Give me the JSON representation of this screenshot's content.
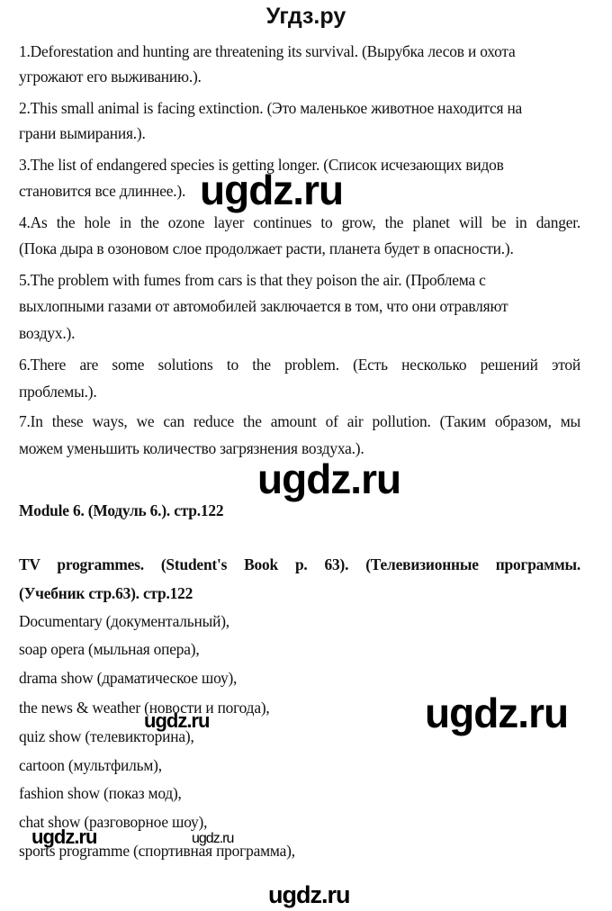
{
  "header": {
    "site_title": "Угдз.ру"
  },
  "sentences": [
    {
      "line1": "1.Deforestation and hunting are threatening its survival. (Вырубка лесов и охота",
      "line2": "угрожают его выживанию.)."
    },
    {
      "line1": "2.This small animal is facing extinction. (Это маленькое животное находится на",
      "line2": "грани вымирания.)."
    },
    {
      "line1": "3.The list of endangered species is getting longer. (Список исчезающих видов",
      "line2": "становится все длиннее.)."
    },
    {
      "line1": "4.As the hole in the ozone layer continues to grow, the planet will be in danger.",
      "line2": "(Пока дыра в озоновом слое продолжает расти, планета будет в опасности.)."
    },
    {
      "line1": "5.The problem with fumes from cars is that they poison the air. (Проблема с",
      "line2": "выхлопными газами от автомобилей заключается в том, что они отравляют",
      "line3": "воздух.)."
    },
    {
      "line1": "6.There are some solutions to the problem. (Есть несколько решений этой",
      "line2": "проблемы.)."
    },
    {
      "line1": "7.In these ways, we can reduce the amount of air pollution. (Таким образом, мы",
      "line2": "можем уменьшить количество загрязнения воздуха.)."
    }
  ],
  "module_heading": "Module 6. (Модуль 6.). стр.122",
  "section_heading": {
    "line1": "TV programmes. (Student's Book p. 63). (Телевизионные программы.",
    "line2": "(Учебник стр.63). стр.122"
  },
  "tv_programmes": [
    "Documentary (документальный),",
    "soap opera (мыльная опера),",
    "drama show (драматическое шоу),",
    "the news & weather (новости и погода),",
    "quiz show (телевикторина),",
    "cartoon (мультфильм),",
    "fashion show (показ мод),",
    "chat show (разговорное шоу),",
    "sports programme (спортивная программа),"
  ],
  "watermarks": {
    "text": "ugdz.ru"
  }
}
